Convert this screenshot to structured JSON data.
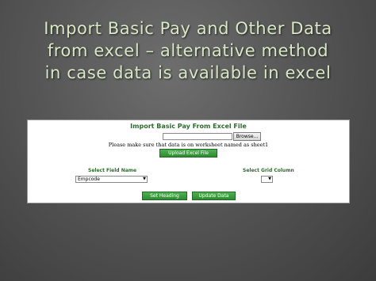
{
  "slide": {
    "title_lines": [
      "Import Basic Pay and Other Data",
      "from excel – alternative method",
      "in case data is available in excel"
    ]
  },
  "form": {
    "title": "Import Basic Pay From Excel File",
    "file_input_value": "",
    "browse_label": "Browse...",
    "note": "Please make sure that data is on worksheet named as sheet1",
    "upload_label": "Upload Excel File",
    "select_field_label": "Select Field Name",
    "select_field_value": "Empcode",
    "select_grid_label": "Select Grid Column",
    "select_grid_value": "",
    "set_heading_label": "Set Heading",
    "update_data_label": "Update Data"
  },
  "colors": {
    "accent_green": "#2f8b32",
    "title_text": "#d8e8c4",
    "label_green": "#2c6b2c"
  }
}
